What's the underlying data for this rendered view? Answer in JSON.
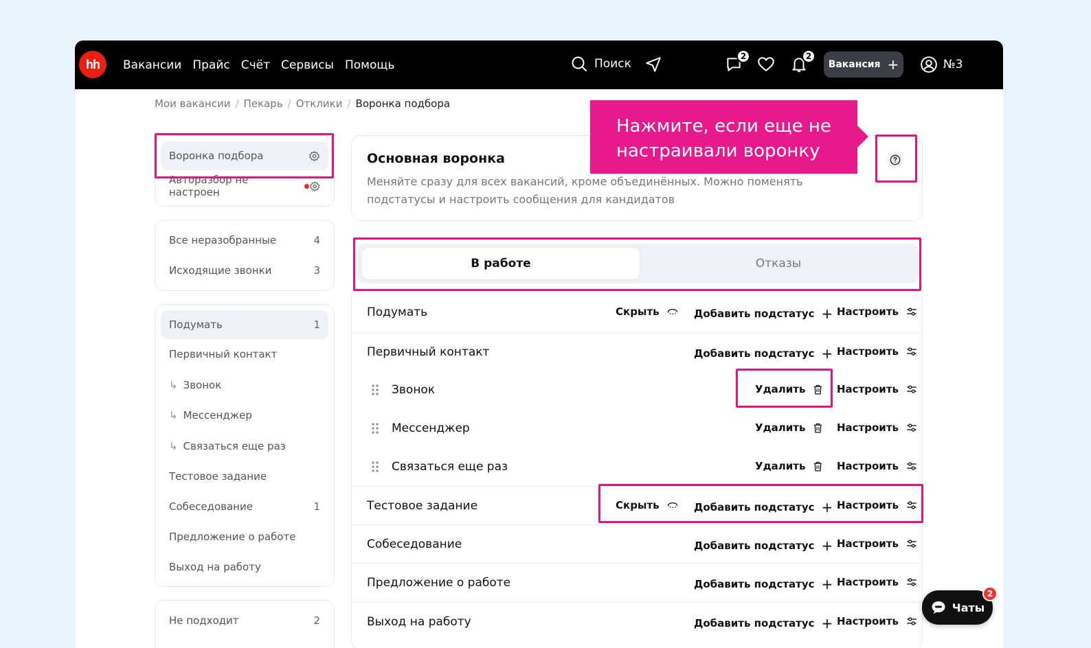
{
  "nav": {
    "logo": "hh",
    "links": [
      "Вакансии",
      "Прайс",
      "Счёт",
      "Сервисы",
      "Помощь"
    ],
    "search": "Поиск",
    "messages_badge": "2",
    "notifications_badge": "2",
    "vacancy_button": "Вакансия",
    "account": "№3"
  },
  "breadcrumb": [
    "Мои вакансии",
    "Пекарь",
    "Отклики",
    "Воронка подбора"
  ],
  "sidebar": {
    "settings": [
      {
        "label": "Воронка подбора"
      },
      {
        "label": "Автоазбор не настроен"
      }
    ],
    "inbox": [
      {
        "label": "Все неразобранные",
        "count": "4"
      },
      {
        "label": "Исходящие звонки",
        "count": "3"
      }
    ],
    "stages": [
      {
        "label": "Подумать",
        "count": "1"
      },
      {
        "label": "Первичный контакт",
        "count": ""
      },
      {
        "label": "Звонок",
        "count": ""
      },
      {
        "label": "Мессенджер",
        "count": ""
      },
      {
        "label": "Связаться еще раз",
        "count": ""
      },
      {
        "label": "Тестовое задание",
        "count": ""
      },
      {
        "label": "Собеседование",
        "count": "1"
      },
      {
        "label": "Предложение о работе",
        "count": ""
      },
      {
        "label": "Выход на работу",
        "count": ""
      }
    ],
    "rejects": [
      {
        "label": "Не подходит",
        "count": "2"
      }
    ]
  },
  "main": {
    "title": "Основная воронка",
    "description": "Меняйте сразу для всех вакансий, кроме объединённых. Можно поменять подстатусы и настроить сообщения для кандидатов",
    "tabs": [
      "В работе",
      "Отказы"
    ],
    "actions": {
      "hide": "Скрыть",
      "add_substatus": "Добавить подстатус",
      "configure": "Настроить",
      "delete": "Удалить"
    },
    "rows": [
      {
        "name": "Подумать"
      },
      {
        "name": "Первичный контакт"
      },
      {
        "name": "Звонок"
      },
      {
        "name": "Мессенджер"
      },
      {
        "name": "Связаться еще раз"
      },
      {
        "name": "Тестовое задание"
      },
      {
        "name": "Собеседование"
      },
      {
        "name": "Предложение о работе"
      },
      {
        "name": "Выход на работу"
      }
    ]
  },
  "tooltip": "Нажмите, если еще не настраивали воронку",
  "chats": {
    "label": "Чаты",
    "badge": "2"
  },
  "colors": {
    "highlight": "#e0167f",
    "tooltip": "#e8198b",
    "logo": "#e8200f",
    "nav_bg": "#000000"
  }
}
